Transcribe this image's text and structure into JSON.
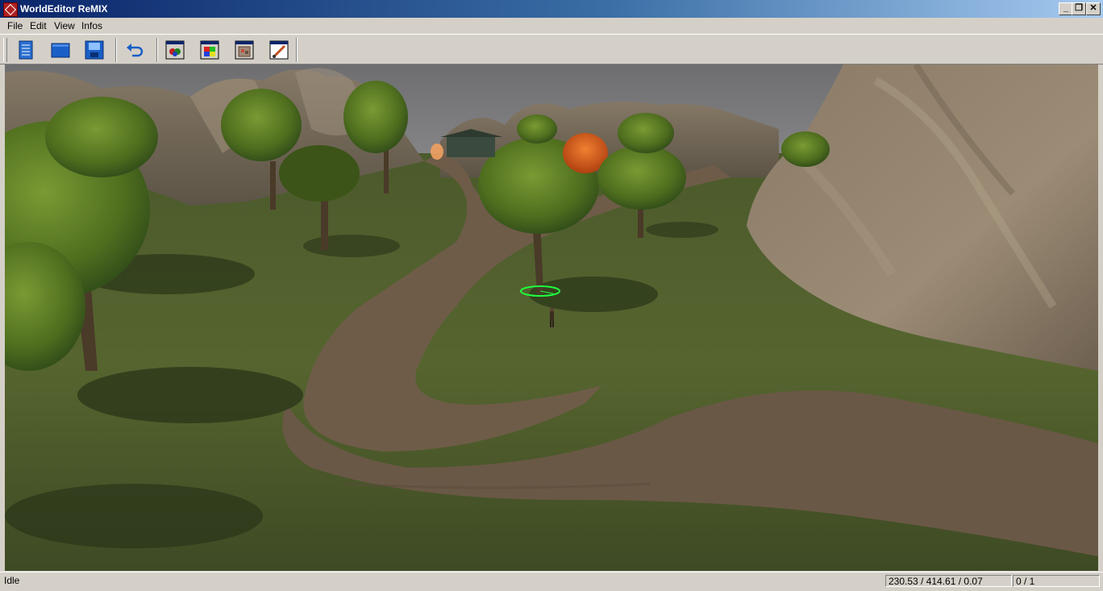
{
  "window": {
    "title": "WorldEditor ReMIX",
    "minimize": "_",
    "restore": "❐",
    "close": "✕"
  },
  "menu": [
    "File",
    "Edit",
    "View",
    "Infos"
  ],
  "toolbar": {
    "buttons": [
      "new-file-icon",
      "open-folder-icon",
      "save-disk-icon",
      "undo-icon",
      "objects-window-icon",
      "colors-window-icon",
      "textures-window-icon",
      "paint-brush-window-icon"
    ]
  },
  "status": {
    "text": "Idle",
    "coords": "230.53 / 414.61 / 0.07",
    "selection": "0 / 1"
  }
}
